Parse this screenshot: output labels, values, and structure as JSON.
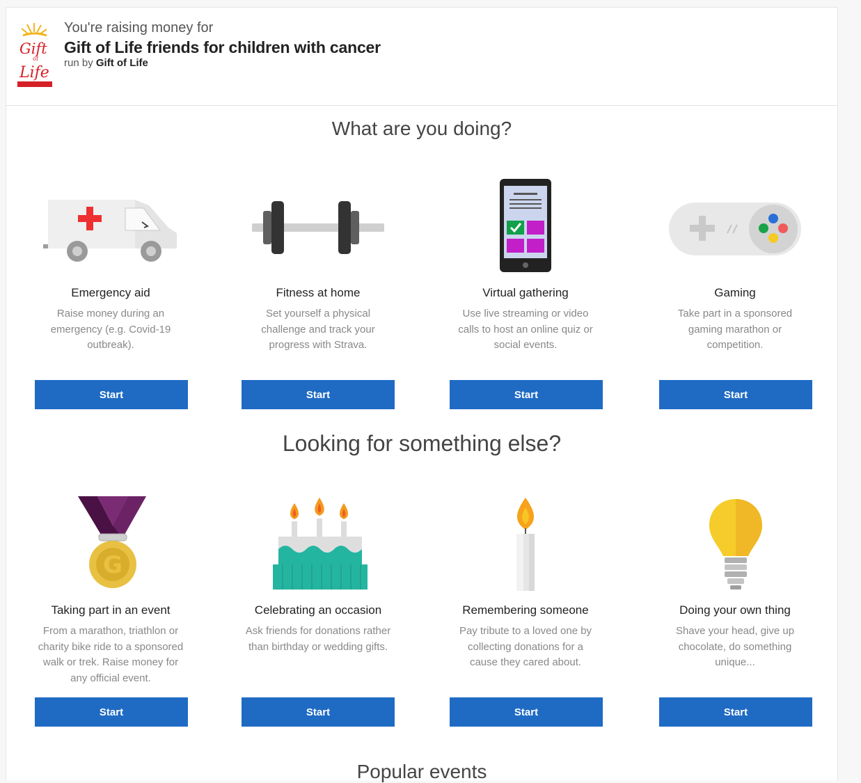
{
  "header": {
    "raising_label": "You're raising money for",
    "charity_name": "Gift of Life friends for children with cancer",
    "run_by_prefix": "run by",
    "run_by_name": "Gift of Life"
  },
  "sections": {
    "doing_title": "What are you doing?",
    "else_title": "Looking for something else?",
    "popular_title": "Popular events"
  },
  "row1": [
    {
      "name": "Emergency aid",
      "desc": "Raise money during an emergency (e.g. Covid-19 outbreak).",
      "button": "Start",
      "icon": "ambulance-icon"
    },
    {
      "name": "Fitness at home",
      "desc": "Set yourself a physical challenge and track your progress with Strava.",
      "button": "Start",
      "icon": "dumbbell-icon"
    },
    {
      "name": "Virtual gathering",
      "desc": "Use live streaming or video calls to host an online quiz or social events.",
      "button": "Start",
      "icon": "smartphone-icon"
    },
    {
      "name": "Gaming",
      "desc": "Take part in a sponsored gaming marathon or competition.",
      "button": "Start",
      "icon": "gamepad-icon"
    }
  ],
  "row2": [
    {
      "name": "Taking part in an event",
      "desc": "From a marathon, triathlon or charity bike ride to a sponsored walk or trek. Raise money for any official event.",
      "button": "Start",
      "icon": "medal-icon"
    },
    {
      "name": "Celebrating an occasion",
      "desc": "Ask friends for donations rather than birthday or wedding gifts.",
      "button": "Start",
      "icon": "cake-icon"
    },
    {
      "name": "Remembering someone",
      "desc": "Pay tribute to a loved one by collecting donations for a cause they cared about.",
      "button": "Start",
      "icon": "candle-icon"
    },
    {
      "name": "Doing your own thing",
      "desc": "Shave your head, give up chocolate, do something unique...",
      "button": "Start",
      "icon": "lightbulb-icon"
    }
  ],
  "colors": {
    "button": "#1f6bc4",
    "logo_red": "#d52027"
  }
}
